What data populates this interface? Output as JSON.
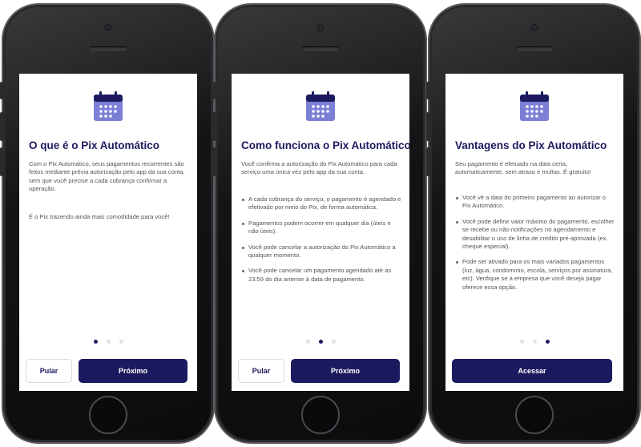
{
  "colors": {
    "primary": "#1c1a5e",
    "icon": "#7b7fd6",
    "text": "#555555",
    "dot_inactive": "#dfe2ea"
  },
  "screens": [
    {
      "icon": "calendar-icon",
      "title": "O que é o Pix Automático",
      "body": [
        "Com o Pix Automático, seus pagamentos recorrentes são feitos mediante prévia autorização pelo app da sua conta, sem que você precise a cada cobrança confirmar a operação.",
        "É o Pix trazendo ainda mais comodidade para você!"
      ],
      "page_indicator": {
        "count": 3,
        "active": 1
      },
      "buttons": {
        "secondary": "Pular",
        "primary": "Próximo"
      }
    },
    {
      "icon": "calendar-icon",
      "title": "Como funciona o Pix Automático",
      "body": [
        "Você confirma a autorização do Pix Automático para cada serviço uma única vez pelo app da sua conta."
      ],
      "bullets": [
        "A cada cobrança do serviço, o pagamento é agendado e efetivado por meio do Pix, de forma automática.",
        "Pagamentos podem ocorrer em qualquer dia (úteis e não úteis).",
        "Você pode cancelar a autorização do Pix Automático a qualquer momento.",
        "Você pode cancelar um pagamento agendado até as 23:59 do dia anterior à data de pagamento."
      ],
      "page_indicator": {
        "count": 3,
        "active": 2
      },
      "buttons": {
        "secondary": "Pular",
        "primary": "Próximo"
      }
    },
    {
      "icon": "calendar-icon",
      "title": "Vantagens do Pix Automático",
      "body": [
        "Seu pagamento é efetuado na data certa, automaticamente, sem atraso e multas. É gratuito!"
      ],
      "bullets": [
        "Você vê a data do primeiro pagamento ao autorizar o Pix Automático.",
        "Você pode definir valor máximo do pagamento, escolher se recebe ou não notificações no agendamento e desabilitar o uso de linha de crédito pré-aprovada (ex. cheque especial).",
        "Pode ser ativado para os mais variados pagamentos (luz, água, condomínio, escola, serviços por assinatura, etc). Verifique se a empresa que você deseja pagar oferece essa opção."
      ],
      "page_indicator": {
        "count": 3,
        "active": 3
      },
      "buttons": {
        "primary": "Acessar"
      }
    }
  ]
}
